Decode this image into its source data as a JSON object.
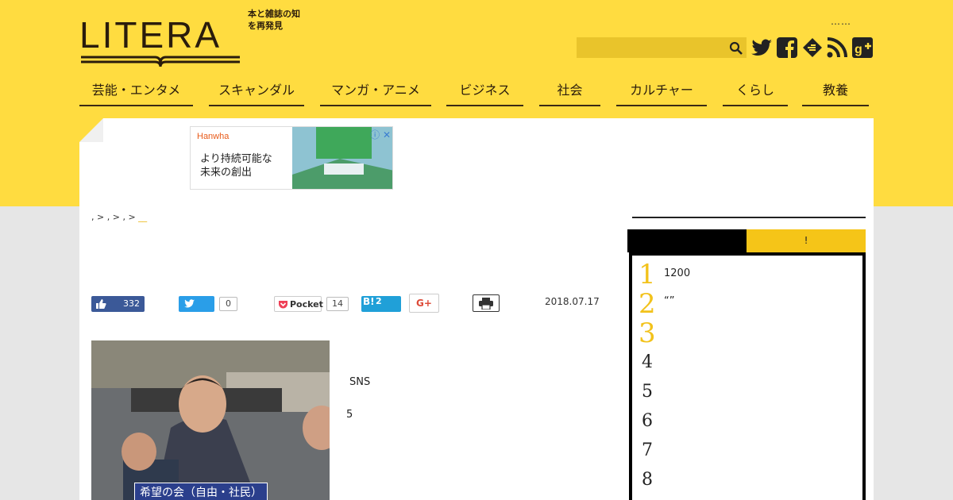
{
  "brand": {
    "logo": "LITERA",
    "tagline": "本と雑誌の知を再発見"
  },
  "top_dots": "……",
  "nav": [
    "芸能・エンタメ",
    "スキャンダル",
    "マンガ・アニメ",
    "ビジネス",
    "社会",
    "カルチャー",
    "くらし",
    "教養"
  ],
  "ad": {
    "brand": "Hanwha",
    "text": "より持続可能な未来の創出",
    "close": "ⓘ ✕"
  },
  "breadcrumb": {
    "parts": [
      ",",
      ">",
      ",",
      ">",
      ",",
      ">"
    ],
    "current": "__"
  },
  "share": {
    "like_count": "332",
    "tweet_count": "0",
    "pocket_label": "Pocket",
    "pocket_count": "14",
    "hatena_label": "B!",
    "hatena_count": "2",
    "gplus_label": "G+"
  },
  "date": "2018.07.17",
  "photo_caption": "希望の会（自由・社民）",
  "body": {
    "line1": "SNS",
    "line2": "5"
  },
  "ranking": {
    "tab_right": "!",
    "items": [
      {
        "num": "1",
        "title": "1200"
      },
      {
        "num": "2",
        "title": "“”"
      },
      {
        "num": "3",
        "title": ""
      },
      {
        "num": "4",
        "title": ""
      },
      {
        "num": "5",
        "title": ""
      },
      {
        "num": "6",
        "title": ""
      },
      {
        "num": "7",
        "title": ""
      },
      {
        "num": "8",
        "title": ""
      }
    ]
  },
  "colors": {
    "brand_yellow": "#ffdc40",
    "rank_yellow": "#f2c21b",
    "twitter": "#2a9ee8",
    "facebook": "#3b5998",
    "hatena": "#20a0d8"
  }
}
